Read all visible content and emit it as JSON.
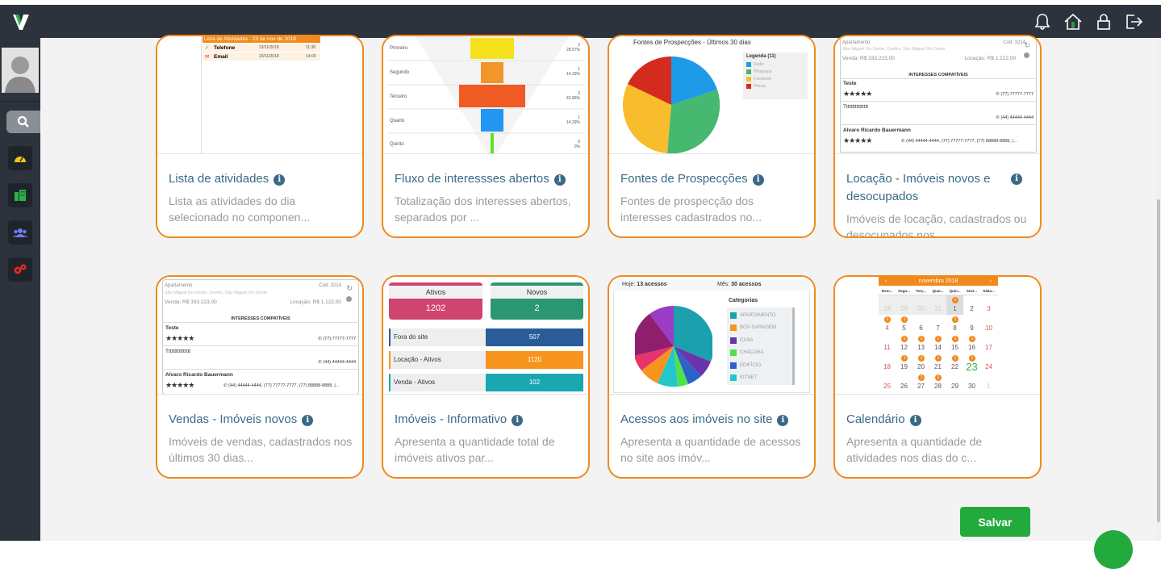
{
  "app": {
    "logo": "V"
  },
  "topbar": {
    "icons": [
      "bell-icon",
      "home-icon",
      "lock-icon",
      "logout-icon"
    ]
  },
  "sidebar": {
    "items": [
      "search-icon",
      "dashboard-icon",
      "building-icon",
      "users-icon",
      "settings-icon"
    ]
  },
  "cards": [
    {
      "title": "Lista de atividades",
      "desc": "Lista as atividades do dia selecionado no componen...",
      "preview": {
        "header": "Lista de Atividades - 23 de nov de 2018",
        "rows": [
          {
            "label": "Telefone",
            "date": "23/11/2018",
            "time": "11:36"
          },
          {
            "label": "Email",
            "date": "23/11/2018",
            "time": "14:00"
          }
        ]
      }
    },
    {
      "title": "Fluxo de interessses abertos",
      "desc": "Totalização dos interesses abertos, separados por ...",
      "preview": {
        "stages": [
          {
            "label": "Primeiro",
            "count": "2",
            "pct": "28.57%"
          },
          {
            "label": "Segundo",
            "count": "1",
            "pct": "14.29%"
          },
          {
            "label": "Terceiro",
            "count": "3",
            "pct": "42.86%"
          },
          {
            "label": "Quarto",
            "count": "1",
            "pct": "14.29%"
          },
          {
            "label": "Quinto",
            "count": "0",
            "pct": "0%"
          }
        ]
      }
    },
    {
      "title": "Fontes de Prospecções",
      "desc": "Fontes de prospecção dos interesses cadastrados no...",
      "preview": {
        "title": "Fontes de Prospecções - Últimos 30 dias",
        "legend_title": "Legenda (11)",
        "legend": [
          "Rádio",
          "Whatsapp",
          "Facebook",
          "Placas"
        ]
      }
    },
    {
      "title": "Locação - Imóveis novos e desocupados",
      "desc": "Imóveis de locação, cadastrados ou desocupados nos...",
      "preview": {
        "type": "Apartamento",
        "code": "Cód: 3214",
        "address": "São Miguel Do Oeste, Centro, São Miguel Do Oeste",
        "sale": "Venda: R$ 333.223,00",
        "rent": "Locação: R$ 1.122,00",
        "section": "INTERESSES COMPATÍVEIS",
        "people": [
          {
            "name": "Teste",
            "phone": "(77) 77777-7777"
          },
          {
            "name": "Tttttttttttttttt",
            "phone": "(44) 44444-4444"
          },
          {
            "name": "Alvaro Ricardo Bauermann",
            "phone": "(44) 44444-4444, (77) 77777-7777, (77) 88888-8888, |..."
          }
        ]
      }
    },
    {
      "title": "Vendas - Imóveis novos",
      "desc": "Imóveis de vendas, cadastrados nos últimos 30 dias...",
      "preview": {
        "type": "Apartamento",
        "code": "Cód: 3214",
        "address": "São Miguel Do Oeste, Centro, São Miguel Do Oeste",
        "sale": "Venda: R$ 333.223,00",
        "rent": "Locação: R$ 1.122,00",
        "section": "INTERESSES COMPATÍVEIS",
        "people": [
          {
            "name": "Teste",
            "phone": "(77) 77777-7777"
          },
          {
            "name": "Tttttttttttttttt",
            "phone": "(44) 44444-4444"
          },
          {
            "name": "Alvaro Ricardo Bauermann",
            "phone": "(44) 44444-4444, (77) 77777-7777, (77) 88888-8888, |..."
          }
        ]
      }
    },
    {
      "title": "Imóveis - Informativo",
      "desc": "Apresenta a quantidade total de imóveis ativos par...",
      "preview": {
        "ativos_label": "Ativos",
        "ativos": "1202",
        "novos_label": "Novos",
        "novos": "2",
        "rows": [
          {
            "label": "Fora do site",
            "value": "507",
            "color": "#2a5c9a"
          },
          {
            "label": "Locação - Ativos",
            "value": "1120",
            "color": "#f7941d"
          },
          {
            "label": "Venda - Ativos",
            "value": "102",
            "color": "#19a7b2"
          }
        ]
      }
    },
    {
      "title": "Acessos aos imóveis no site",
      "desc": "Apresenta a quantidade de acessos no site aos imóv...",
      "preview": {
        "hoje_label": "Hoje:",
        "hoje": "13 acessos",
        "mes_label": "Mês:",
        "mes": "30 acessos",
        "cat_title": "Categorias",
        "categories": [
          "APARTAMENTO",
          "BOX GARAGEM",
          "CASA",
          "CHÁCARA",
          "EDIFÍCIO",
          "KITNET"
        ]
      }
    },
    {
      "title": "Calendário",
      "desc": "Apresenta a quantidade de atividades nos dias do c...",
      "preview": {
        "month": "novembro 2018",
        "weekdays": [
          "Dom...",
          "Segu...",
          "Terç...",
          "Quar...",
          "Quin...",
          "Sext...",
          "Sába..."
        ],
        "weeks": [
          [
            "28",
            "29",
            "30",
            "31",
            "1",
            "2",
            "3"
          ],
          [
            "4",
            "5",
            "6",
            "7",
            "8",
            "9",
            "10"
          ],
          [
            "11",
            "12",
            "13",
            "14",
            "15",
            "16",
            "17"
          ],
          [
            "18",
            "19",
            "20",
            "21",
            "22",
            "23",
            "24"
          ],
          [
            "25",
            "26",
            "27",
            "28",
            "29",
            "30",
            "1"
          ]
        ]
      }
    }
  ],
  "actions": {
    "save": "Salvar"
  }
}
